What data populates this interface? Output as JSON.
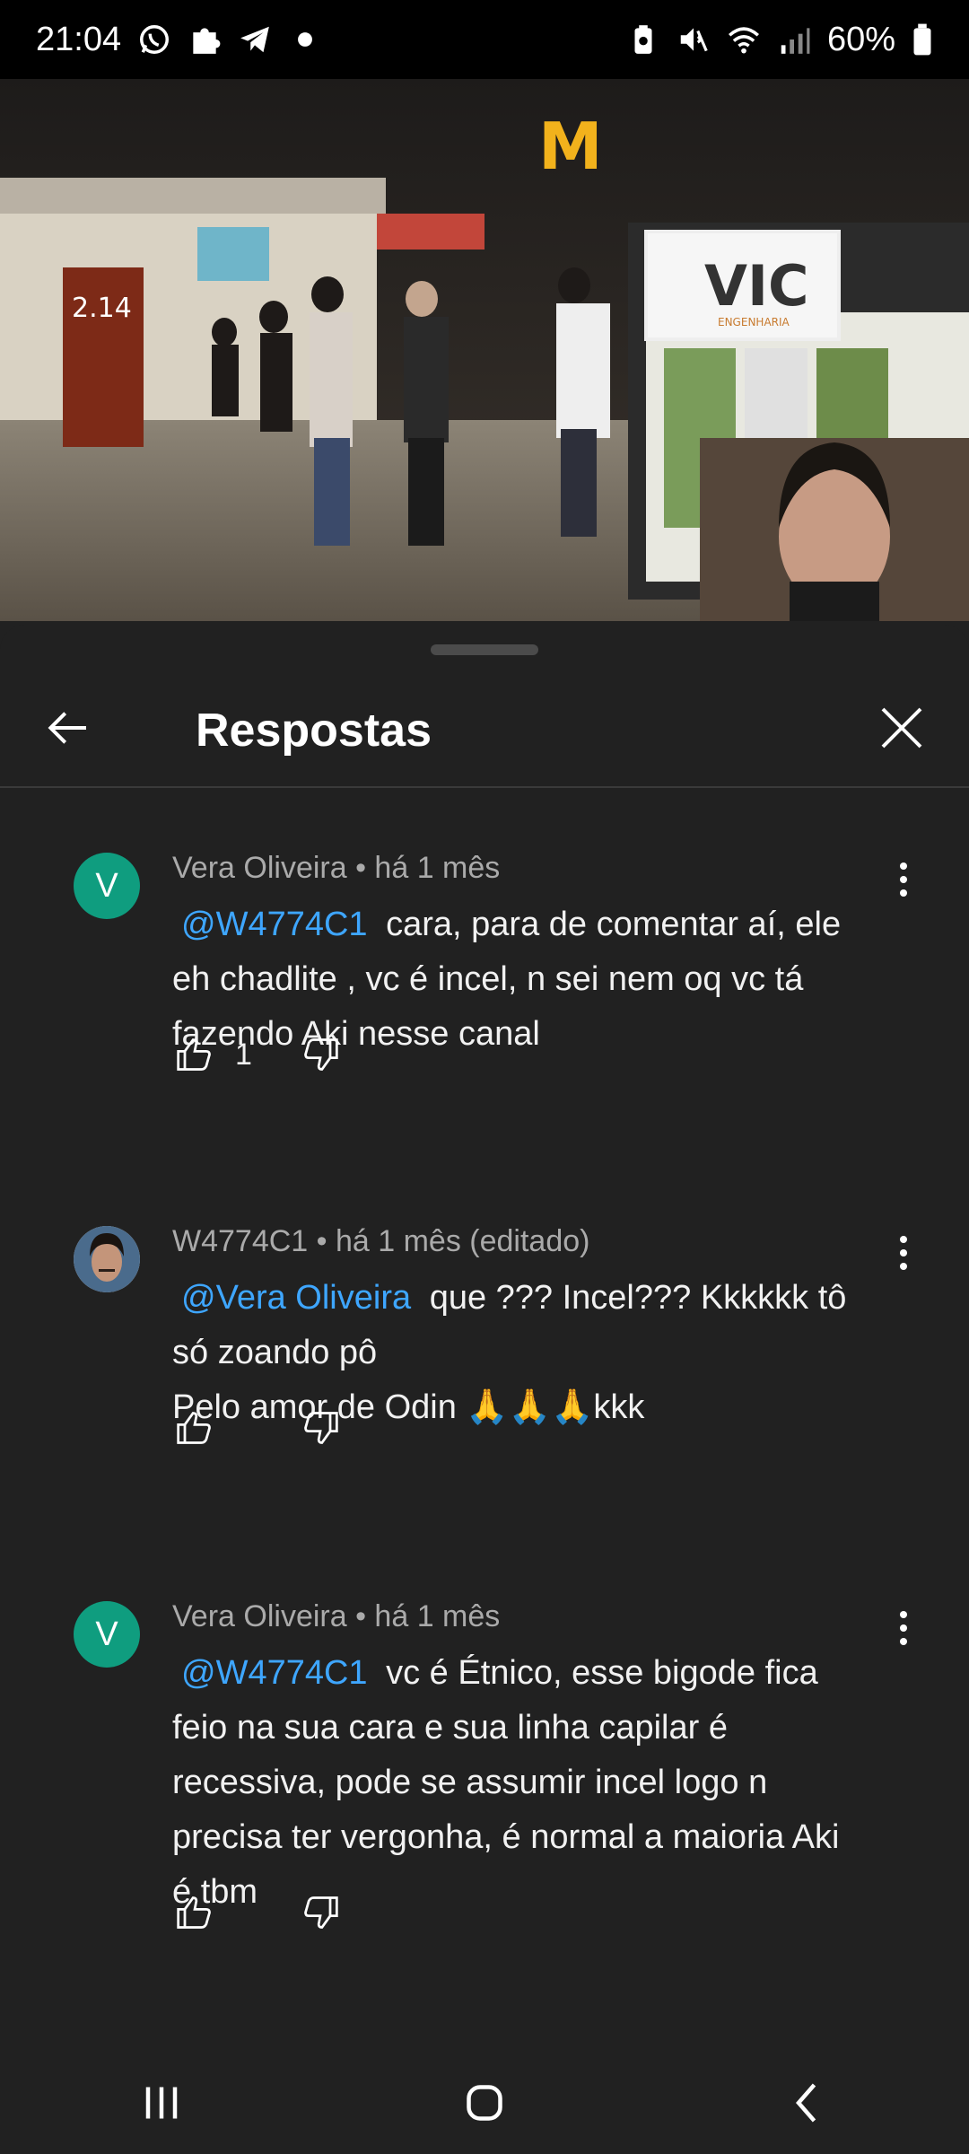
{
  "status_bar": {
    "time": "21:04",
    "battery": "60%",
    "left_icons": [
      "whatsapp-icon",
      "puzzle-icon",
      "telegram-icon",
      "dot-icon"
    ],
    "right_icons": [
      "battery-saver-icon",
      "mute-icon",
      "wifi-icon",
      "signal-icon",
      "battery-icon"
    ]
  },
  "video": {
    "progress_fraction": 0.56,
    "buffer_fraction": 0.59,
    "sign_text": "VIC",
    "sign_subtext": "ENGENHARIA",
    "menu_text": "2.14",
    "colors": {
      "progress": "#ff0000",
      "mention": "#3ea6ff",
      "avatar_v": "#0f9d7f"
    }
  },
  "sheet": {
    "title": "Respostas",
    "back_icon": "arrow-left-icon",
    "close_icon": "close-icon"
  },
  "comments": [
    {
      "author": "Vera Oliveira",
      "meta": "Vera Oliveira • há 1 mês",
      "avatar_letter": "V",
      "mention": "@W4774C1",
      "text_lines": [
        "cara, para de comentar aí, ele",
        "eh chadlite , vc é incel, n sei nem oq vc tá",
        "fazendo Aki nesse canal"
      ],
      "likes": "1"
    },
    {
      "author": "W4774C1",
      "meta": "W4774C1 • há 1 mês (editado)",
      "mention": "@Vera Oliveira",
      "text_lines": [
        "que ??? Incel??? Kkkkkk tô",
        "só zoando pô",
        "Pelo amor de Odin 🙏🙏🙏kkk"
      ],
      "likes": ""
    },
    {
      "author": "Vera Oliveira",
      "meta": "Vera Oliveira • há 1 mês",
      "avatar_letter": "V",
      "mention": "@W4774C1",
      "text_lines": [
        "vc é Étnico, esse bigode fica",
        "feio na sua cara e sua linha capilar é",
        "recessiva, pode se assumir incel logo n",
        "precisa ter vergonha, é normal a maioria Aki",
        "é tbm"
      ],
      "likes": ""
    }
  ],
  "nav_bar": {
    "buttons": [
      "recent-apps-icon",
      "home-icon",
      "back-icon"
    ]
  }
}
